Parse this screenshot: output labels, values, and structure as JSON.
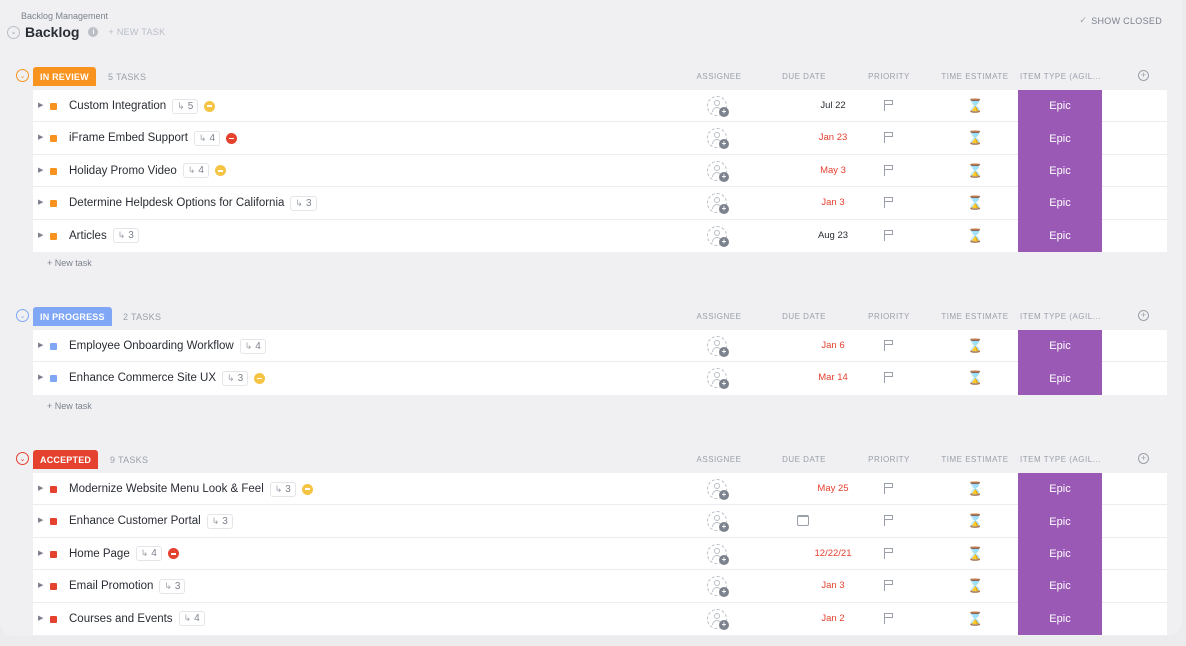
{
  "header": {
    "breadcrumb": "Backlog Management",
    "title": "Backlog",
    "new_task": "+ NEW TASK",
    "show_closed": "SHOW CLOSED"
  },
  "columns": {
    "assignee": "ASSIGNEE",
    "due_date": "DUE DATE",
    "priority": "PRIORITY",
    "time_estimate": "TIME ESTIMATE",
    "item_type": "ITEM TYPE (AGIL..."
  },
  "colors": {
    "in_review": "#f7931e",
    "in_progress": "#7fa7f5",
    "accepted": "#e5412f",
    "epic": "#9b59b6"
  },
  "new_task_link": "+ New task",
  "groups": [
    {
      "status": "IN REVIEW",
      "count": "5 TASKS",
      "tasks": [
        {
          "name": "Custom Integration",
          "subtasks": "5",
          "priority": "yellow",
          "due": "Jul 22",
          "due_color": "black",
          "type": "Epic"
        },
        {
          "name": "iFrame Embed Support",
          "subtasks": "4",
          "priority": "red",
          "due": "Jan 23",
          "due_color": "red",
          "type": "Epic"
        },
        {
          "name": "Holiday Promo Video",
          "subtasks": "4",
          "priority": "yellow",
          "due": "May 3",
          "due_color": "red",
          "type": "Epic"
        },
        {
          "name": "Determine Helpdesk Options for California",
          "subtasks": "3",
          "priority": "",
          "due": "Jan 3",
          "due_color": "red",
          "type": "Epic"
        },
        {
          "name": "Articles",
          "subtasks": "3",
          "priority": "",
          "due": "Aug 23",
          "due_color": "black",
          "type": "Epic"
        }
      ]
    },
    {
      "status": "IN PROGRESS",
      "count": "2 TASKS",
      "tasks": [
        {
          "name": "Employee Onboarding Workflow",
          "subtasks": "4",
          "priority": "",
          "due": "Jan 6",
          "due_color": "red",
          "type": "Epic"
        },
        {
          "name": "Enhance Commerce Site UX",
          "subtasks": "3",
          "priority": "yellow",
          "due": "Mar 14",
          "due_color": "red",
          "type": "Epic"
        }
      ]
    },
    {
      "status": "ACCEPTED",
      "count": "9 TASKS",
      "tasks": [
        {
          "name": "Modernize Website Menu Look & Feel",
          "subtasks": "3",
          "priority": "yellow",
          "due": "May 25",
          "due_color": "red",
          "type": "Epic"
        },
        {
          "name": "Enhance Customer Portal",
          "subtasks": "3",
          "priority": "",
          "due": "",
          "due_color": "",
          "type": "Epic"
        },
        {
          "name": "Home Page",
          "subtasks": "4",
          "priority": "red",
          "due": "12/22/21",
          "due_color": "red",
          "type": "Epic"
        },
        {
          "name": "Email Promotion",
          "subtasks": "3",
          "priority": "",
          "due": "Jan 3",
          "due_color": "red",
          "type": "Epic"
        },
        {
          "name": "Courses and Events",
          "subtasks": "4",
          "priority": "",
          "due": "Jan 2",
          "due_color": "red",
          "type": "Epic"
        }
      ]
    }
  ]
}
